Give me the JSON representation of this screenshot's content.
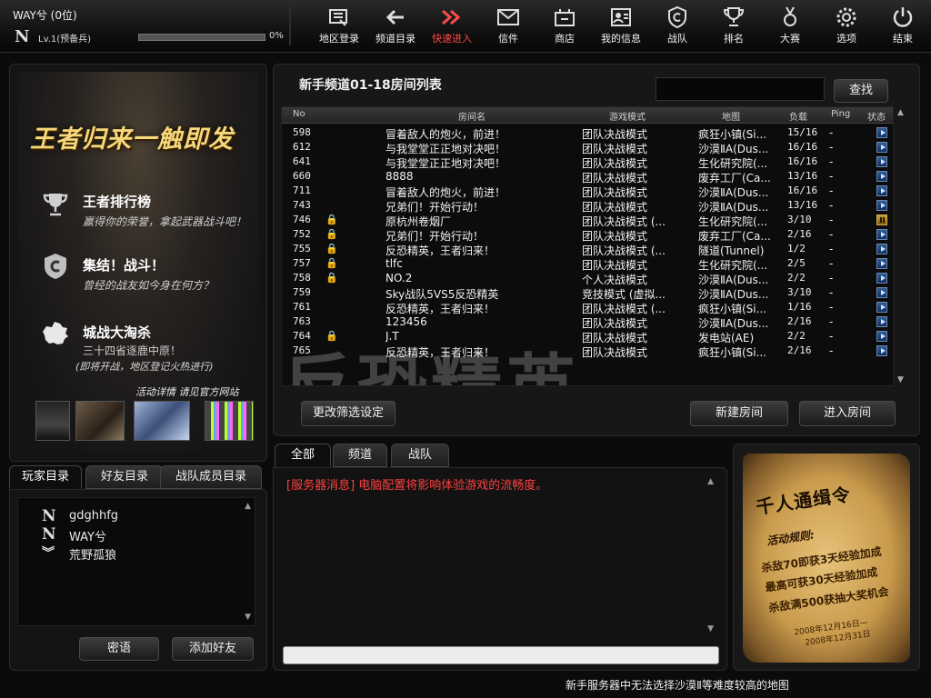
{
  "player": {
    "name": "WAY兮 (0位)",
    "level": "Lv.1(预备兵)",
    "xp_percent": "0%",
    "xp_fraction": 0.0,
    "rank_glyph": "N"
  },
  "nav": [
    {
      "label": "地区登录",
      "icon": "map-login-icon"
    },
    {
      "label": "频道目录",
      "icon": "back-arrow-icon"
    },
    {
      "label": "快速进入",
      "icon": "fast-forward-icon",
      "active": true
    },
    {
      "label": "信件",
      "icon": "mail-icon"
    },
    {
      "label": "商店",
      "icon": "shop-icon"
    },
    {
      "label": "我的信息",
      "icon": "profile-card-icon"
    },
    {
      "label": "战队",
      "icon": "clan-shield-icon"
    },
    {
      "label": "排名",
      "icon": "trophy-icon"
    },
    {
      "label": "大赛",
      "icon": "medal-icon"
    },
    {
      "label": "选项",
      "icon": "gear-icon"
    },
    {
      "label": "结束",
      "icon": "power-icon"
    }
  ],
  "promo": {
    "headline": "王者归来一触即发",
    "features": [
      {
        "title": "王者排行榜",
        "desc": "赢得你的荣誉，拿起武器战斗吧！",
        "icon": "trophy-icon"
      },
      {
        "title": "集结！战斗！",
        "desc": "曾经的战友如今身在何方？",
        "icon": "clan-shield-icon"
      },
      {
        "title": "城战大淘杀",
        "desc": "三十四省逐鹿中原！",
        "icon": "china-map-icon"
      }
    ],
    "note": "(即将开战，地区登记火热进行)",
    "detail": "活动详情 请见官方网站"
  },
  "friends": {
    "tabs": [
      "玩家目录",
      "好友目录",
      "战队成员目录"
    ],
    "active_tab": 0,
    "list": [
      {
        "name": "gdghhfg",
        "icon": "N"
      },
      {
        "name": "WAY兮",
        "icon": "N"
      },
      {
        "name": "荒野孤狼",
        "icon": "︾"
      }
    ],
    "whisper_button": "密语",
    "add_friend_button": "添加好友"
  },
  "rooms": {
    "title": "新手频道01-18房间列表",
    "search_value": "",
    "search_button": "查找",
    "columns": [
      "No",
      "房间名",
      "游戏模式",
      "地图",
      "负载",
      "Ping",
      "状态"
    ],
    "rows": [
      {
        "no": "598",
        "locked": false,
        "name": "冒着敌人的炮火，前进！",
        "mode": "团队决战模式",
        "map": "疯狂小镇(Si...",
        "load": "15/16",
        "ping": "-",
        "status": "play"
      },
      {
        "no": "612",
        "locked": false,
        "name": "与我堂堂正正地对决吧！",
        "mode": "团队决战模式",
        "map": "沙漠ⅡA(Dus...",
        "load": "16/16",
        "ping": "-",
        "status": "play"
      },
      {
        "no": "641",
        "locked": false,
        "name": "与我堂堂正正地对决吧！",
        "mode": "团队决战模式",
        "map": "生化研究院(...",
        "load": "16/16",
        "ping": "-",
        "status": "play"
      },
      {
        "no": "660",
        "locked": false,
        "name": "8888",
        "mode": "团队决战模式",
        "map": "废弃工厂(Ca...",
        "load": "13/16",
        "ping": "-",
        "status": "play"
      },
      {
        "no": "711",
        "locked": false,
        "name": "冒着敌人的炮火，前进！",
        "mode": "团队决战模式",
        "map": "沙漠ⅡA(Dus...",
        "load": "16/16",
        "ping": "-",
        "status": "play"
      },
      {
        "no": "743",
        "locked": false,
        "name": "兄弟们！开始行动！",
        "mode": "团队决战模式",
        "map": "沙漠ⅡA(Dus...",
        "load": "13/16",
        "ping": "-",
        "status": "play"
      },
      {
        "no": "746",
        "locked": true,
        "name": "原杭州卷烟厂",
        "mode": "团队决战模式 (...",
        "map": "生化研究院(...",
        "load": "3/10",
        "ping": "-",
        "status": "paused"
      },
      {
        "no": "752",
        "locked": true,
        "name": "兄弟们！开始行动！",
        "mode": "团队决战模式",
        "map": "废弃工厂(Ca...",
        "load": "2/16",
        "ping": "-",
        "status": "play"
      },
      {
        "no": "755",
        "locked": true,
        "name": "反恐精英，王者归来！",
        "mode": "团队决战模式 (...",
        "map": "隧道(Tunnel)",
        "load": "1/2",
        "ping": "-",
        "status": "play"
      },
      {
        "no": "757",
        "locked": true,
        "name": "tlfc",
        "mode": "团队决战模式",
        "map": "生化研究院(...",
        "load": "2/5",
        "ping": "-",
        "status": "play"
      },
      {
        "no": "758",
        "locked": true,
        "name": "NO.2",
        "mode": "个人决战模式",
        "map": "沙漠ⅡA(Dus...",
        "load": "2/2",
        "ping": "-",
        "status": "play"
      },
      {
        "no": "759",
        "locked": false,
        "name": "Sky战队5VS5反恐精英",
        "mode": "竞技模式 (虚拟...",
        "map": "沙漠ⅡA(Dus...",
        "load": "3/10",
        "ping": "-",
        "status": "play"
      },
      {
        "no": "761",
        "locked": false,
        "name": "反恐精英，王者归来！",
        "mode": "团队决战模式 (...",
        "map": "疯狂小镇(Si...",
        "load": "1/16",
        "ping": "-",
        "status": "play"
      },
      {
        "no": "763",
        "locked": false,
        "name": "123456",
        "mode": "团队决战模式",
        "map": "沙漠ⅡA(Dus...",
        "load": "2/16",
        "ping": "-",
        "status": "play"
      },
      {
        "no": "764",
        "locked": true,
        "name": "J.T",
        "mode": "团队决战模式",
        "map": "发电站(AE)",
        "load": "2/2",
        "ping": "-",
        "status": "play"
      },
      {
        "no": "765",
        "locked": false,
        "name": "反恐精英，王者归来！",
        "mode": "团队决战模式",
        "map": "疯狂小镇(Si...",
        "load": "2/16",
        "ping": "-",
        "status": "play"
      }
    ],
    "filter_button": "更改筛选设定",
    "create_button": "新建房间",
    "enter_button": "进入房间",
    "watermark": "反恐精英"
  },
  "chat": {
    "tabs": [
      "全部",
      "频道",
      "战队"
    ],
    "active_tab": 0,
    "message": "[服务器消息] 电脑配置将影响体验游戏的流畅度。",
    "input_value": ""
  },
  "poster": {
    "title": "千人通缉令",
    "rule_label": "活动规则:",
    "lines": [
      "杀敌70即获3天经验加成",
      "最高可获30天经验加成",
      "杀敌满500获抽大奖机会"
    ],
    "date1": "2008年12月16日—",
    "date2": "2008年12月31日"
  },
  "bottom_note": "新手服务器中无法选择沙漠Ⅱ等难度较高的地图",
  "colors": {
    "accent": "#ff4a4a",
    "lock": "#f0b428",
    "promo_gold": "#f6d77a"
  }
}
